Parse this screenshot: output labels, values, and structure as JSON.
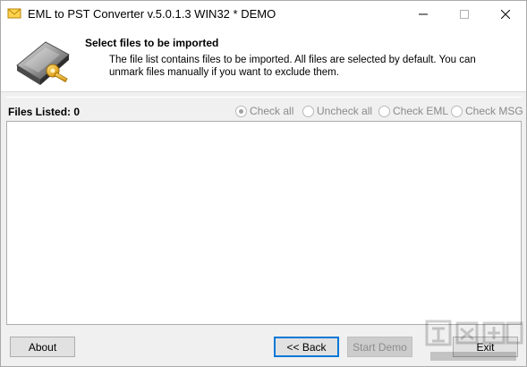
{
  "window": {
    "title": "EML to PST Converter v.5.0.1.3 WIN32 * DEMO"
  },
  "header": {
    "title": "Select files to be imported",
    "description": "The file list contains files to be imported. All files are selected by default. You can unmark files manually if you want to exclude them."
  },
  "files": {
    "label": "Files Listed: 0",
    "options": [
      {
        "label": "Check all",
        "selected": true
      },
      {
        "label": "Uncheck all",
        "selected": false
      },
      {
        "label": "Check EML",
        "selected": false
      },
      {
        "label": "Check MSG",
        "selected": false
      }
    ]
  },
  "buttons": {
    "about": "About",
    "back": "<< Back",
    "start_demo": "Start Demo",
    "exit": "Exit"
  },
  "icons": {
    "app": "envelope-icon",
    "header": "drive-key-icon",
    "minimize": "minimize-icon",
    "maximize": "maximize-icon",
    "close": "close-icon"
  },
  "colors": {
    "focus_border": "#0078d7",
    "disabled_text": "#8d8d8d"
  }
}
